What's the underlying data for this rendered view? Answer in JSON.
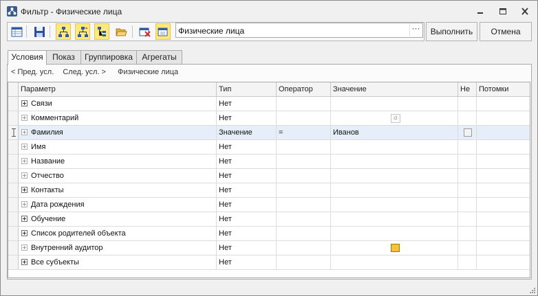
{
  "window": {
    "title": "Фильтр - Физические лица",
    "icon": "org-chart-app-icon"
  },
  "toolbar": {
    "buttons": [
      {
        "name": "grid-settings-icon",
        "active": false
      },
      {
        "name": "save-icon",
        "active": false
      },
      {
        "name": "hierarchy-icon",
        "active": true
      },
      {
        "name": "hierarchy-alt-icon",
        "active": true
      },
      {
        "name": "tree-icon",
        "active": true
      },
      {
        "name": "open-folder-icon",
        "active": false
      },
      {
        "name": "clear-filter-icon",
        "active": false
      },
      {
        "name": "apply-filter-icon",
        "active": true
      }
    ],
    "filter_value": "Физические лица",
    "browse_label": "···",
    "run_label": "Выполнить",
    "cancel_label": "Отмена"
  },
  "tabs": [
    {
      "label": "Условия",
      "active": true
    },
    {
      "label": "Показ",
      "active": false
    },
    {
      "label": "Группировка",
      "active": false
    },
    {
      "label": "Агрегаты",
      "active": false
    }
  ],
  "breadcrumb": {
    "prev": "< Пред. усл.",
    "next": "След. усл. >",
    "current": "Физические лица"
  },
  "grid": {
    "columns": [
      "Параметр",
      "Тип",
      "Оператор",
      "Значение",
      "Не",
      "Потомки"
    ],
    "rows": [
      {
        "param": "Связи",
        "type": "Нет",
        "operator": "",
        "value": "",
        "expander": "normal"
      },
      {
        "param": "Комментарий",
        "type": "Нет",
        "operator": "",
        "value": "",
        "expander": "dim",
        "value_icon": "text-icon"
      },
      {
        "param": "Фамилия",
        "type": "Значение",
        "operator": "=",
        "value": "Иванов",
        "expander": "dim",
        "selected": true,
        "not_checkbox": false
      },
      {
        "param": "Имя",
        "type": "Нет",
        "operator": "",
        "value": "",
        "expander": "dim"
      },
      {
        "param": "Название",
        "type": "Нет",
        "operator": "",
        "value": "",
        "expander": "dim"
      },
      {
        "param": "Отчество",
        "type": "Нет",
        "operator": "",
        "value": "",
        "expander": "dim"
      },
      {
        "param": "Контакты",
        "type": "Нет",
        "operator": "",
        "value": "",
        "expander": "normal"
      },
      {
        "param": "Дата рождения",
        "type": "Нет",
        "operator": "",
        "value": "",
        "expander": "dim"
      },
      {
        "param": "Обучение",
        "type": "Нет",
        "operator": "",
        "value": "",
        "expander": "normal"
      },
      {
        "param": "Список родителей объекта",
        "type": "Нет",
        "operator": "",
        "value": "",
        "expander": "normal"
      },
      {
        "param": "Внутренний аудитор",
        "type": "Нет",
        "operator": "",
        "value": "",
        "expander": "dim",
        "value_icon": "yellow-checkbox-icon"
      },
      {
        "param": "Все субъекты",
        "type": "Нет",
        "operator": "",
        "value": "",
        "expander": "normal"
      }
    ]
  },
  "colors": {
    "selected_row": "#e6eef9",
    "toolbar_active": "#fde97e"
  }
}
